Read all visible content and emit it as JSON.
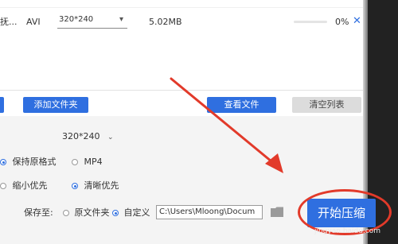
{
  "file_row": {
    "name": "抚...",
    "format": "AVI",
    "resolution": "320*240",
    "size": "5.02MB",
    "progress_percent": "0%",
    "progress_value": 0
  },
  "buttons": {
    "add_folder": "添加文件夹",
    "view_file": "查看文件",
    "clear_list": "清空列表"
  },
  "settings": {
    "resolution": "320*240",
    "format_option_original": "保持原格式",
    "format_option_mp4": "MP4",
    "priority_small": "缩小优先",
    "priority_clear": "清晰优先"
  },
  "save": {
    "label": "保存至:",
    "option_original": "原文件夹",
    "option_custom": "自定义",
    "path": "C:\\Users\\Mloong\\Docum"
  },
  "start_button": "开始压缩",
  "watermark": "jingyan.baidu.com",
  "colors": {
    "accent": "#2f6fe0",
    "annotation_red": "#e23a2a"
  }
}
